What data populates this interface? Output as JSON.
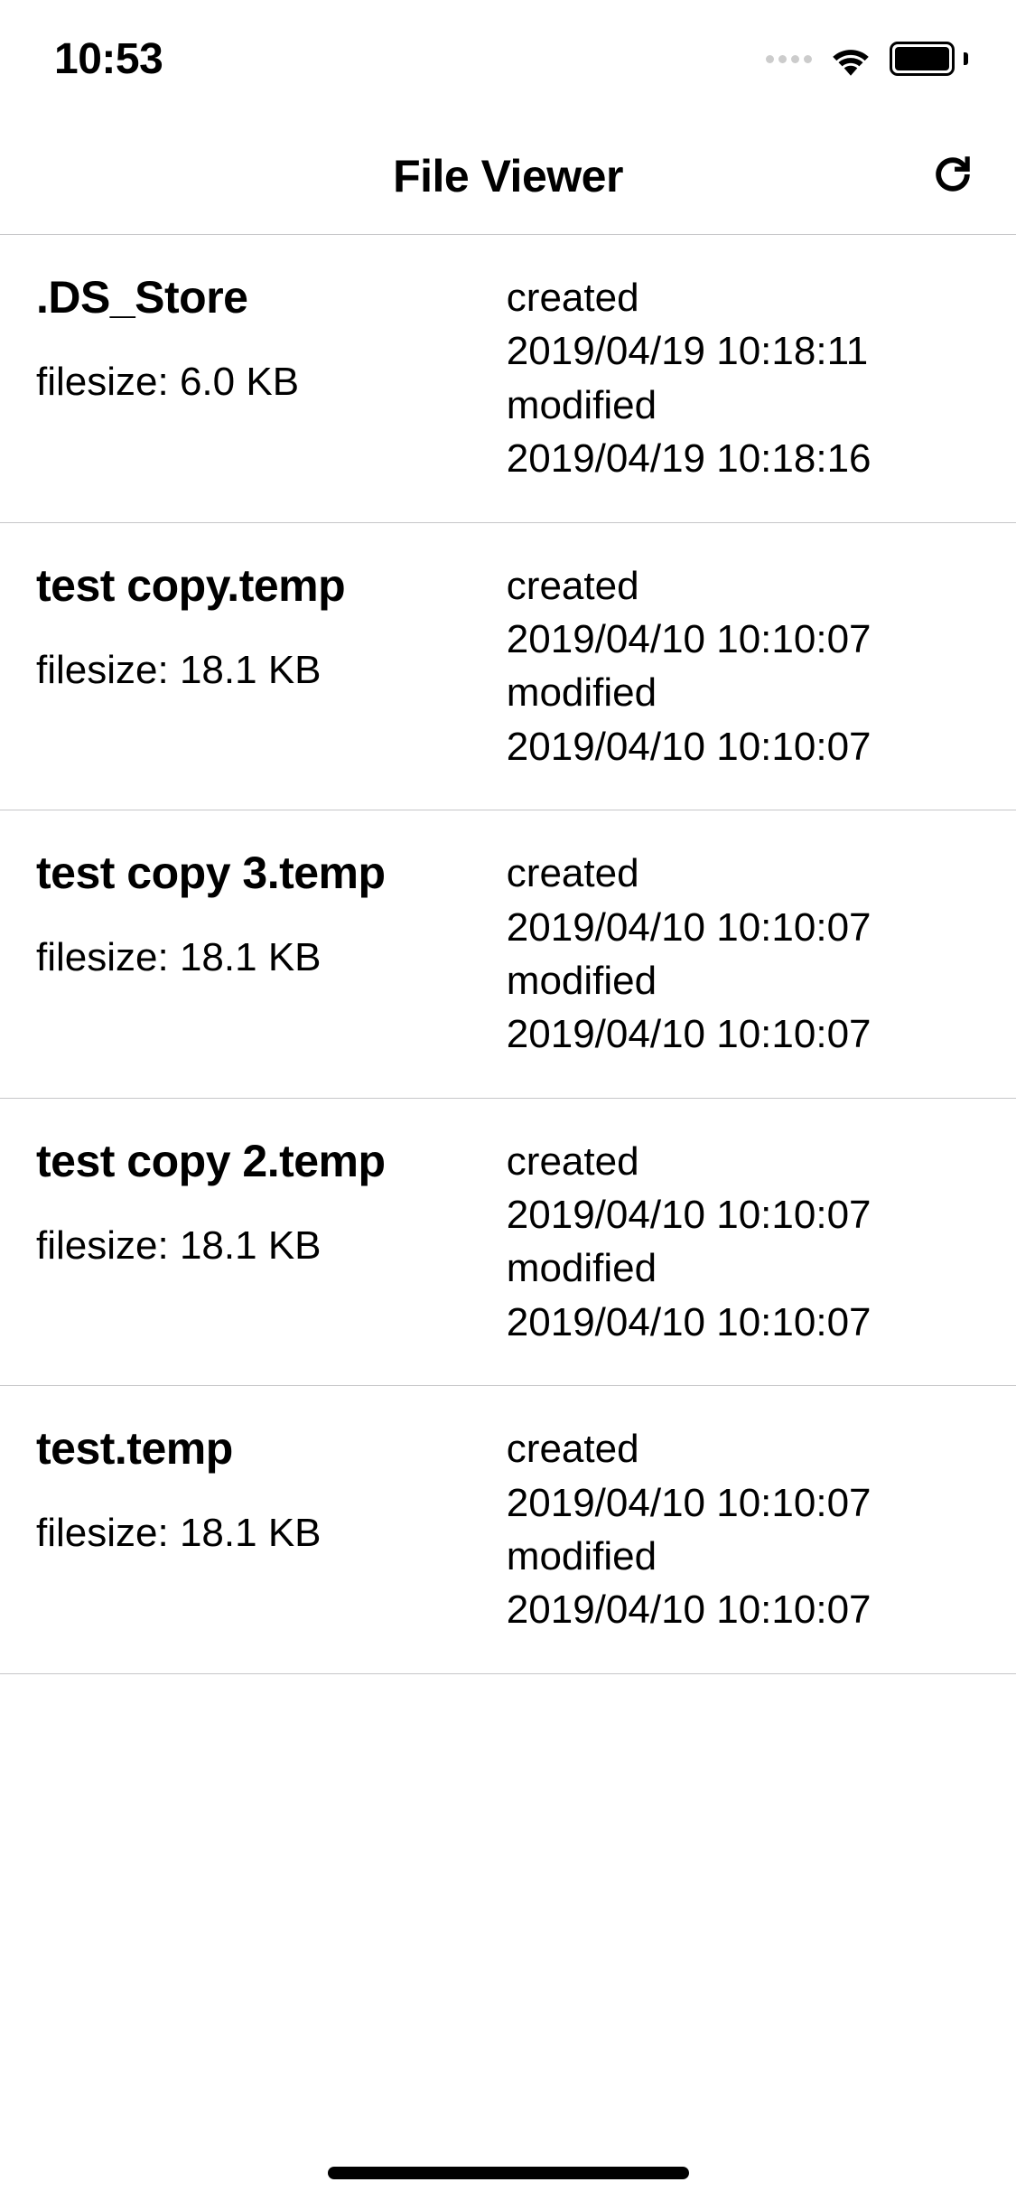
{
  "status": {
    "time": "10:53"
  },
  "nav": {
    "title": "File Viewer"
  },
  "labels": {
    "filesize_prefix": "filesize: ",
    "created": "created",
    "modified": "modified"
  },
  "files": [
    {
      "name": ".DS_Store",
      "filesize": "6.0 KB",
      "created": "2019/04/19 10:18:11",
      "modified": "2019/04/19 10:18:16"
    },
    {
      "name": "test copy.temp",
      "filesize": "18.1 KB",
      "created": "2019/04/10 10:10:07",
      "modified": "2019/04/10 10:10:07"
    },
    {
      "name": "test copy 3.temp",
      "filesize": "18.1 KB",
      "created": "2019/04/10 10:10:07",
      "modified": "2019/04/10 10:10:07"
    },
    {
      "name": "test copy 2.temp",
      "filesize": "18.1 KB",
      "created": "2019/04/10 10:10:07",
      "modified": "2019/04/10 10:10:07"
    },
    {
      "name": "test.temp",
      "filesize": "18.1 KB",
      "created": "2019/04/10 10:10:07",
      "modified": "2019/04/10 10:10:07"
    }
  ]
}
